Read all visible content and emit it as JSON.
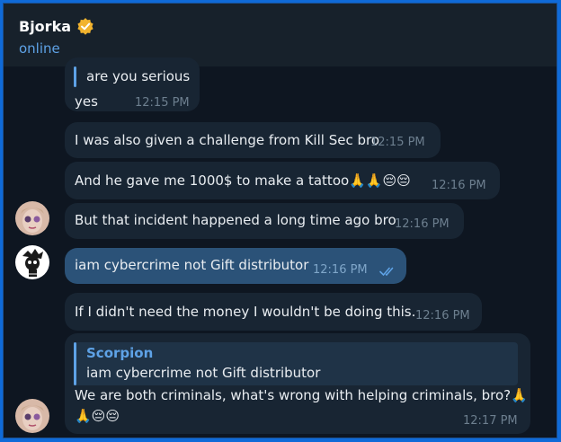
{
  "header": {
    "title": "Bjorka",
    "status": "online",
    "verified_icon": "verified-badge-icon"
  },
  "colors": {
    "accent": "#5ea2e6",
    "incoming_bubble": "#182533",
    "outgoing_bubble": "#2b5278",
    "chat_bg": "#0e1621",
    "header_bg": "#17212b",
    "border": "#0f6ad8"
  },
  "messages": [
    {
      "quote_text": "are you serious",
      "text": "yes",
      "time": "12:15 PM"
    },
    {
      "text": "I was also given a challenge from Kill Sec bro",
      "time": "12:15 PM"
    },
    {
      "text": "And he gave me 1000$ to make a tattoo🙏🙏😔😔",
      "time": "12:16 PM"
    },
    {
      "text": "But that incident happened a long time ago bro",
      "time": "12:16 PM"
    },
    {
      "text": "iam cybercrime not Gift distributor",
      "time": "12:16 PM",
      "read_icon": "double-check-icon"
    },
    {
      "text": "If I didn't need the money I wouldn't be doing this.",
      "time": "12:16 PM"
    },
    {
      "quote_name": "Scorpion",
      "quote_text": "iam cybercrime not Gift distributor",
      "text_line1": "We are both criminals, what's wrong with helping criminals, bro?🙏",
      "text_line2": "🙏😔😔",
      "time": "12:17 PM"
    }
  ]
}
